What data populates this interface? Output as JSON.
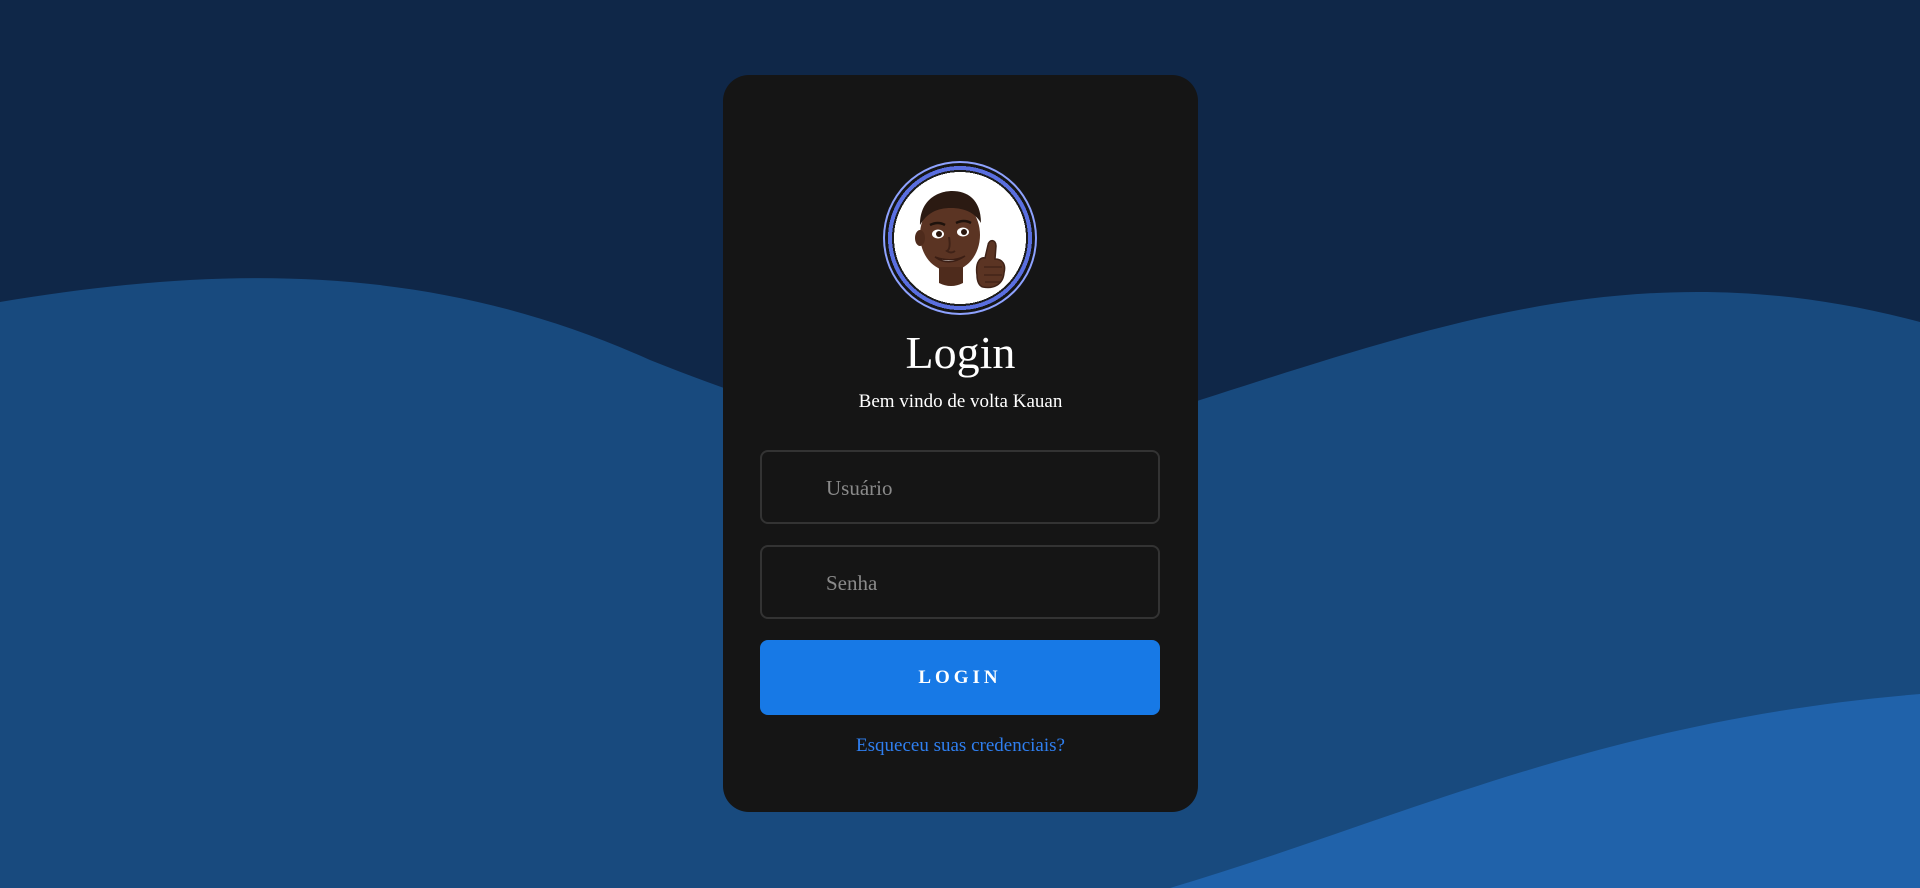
{
  "login": {
    "avatar_name": "memoji-avatar",
    "title": "Login",
    "subtitle": "Bem vindo de volta Kauan",
    "username_placeholder": "Usuário",
    "password_placeholder": "Senha",
    "button_label": "LOGIN",
    "forgot_link": "Esqueceu suas credenciais?"
  },
  "colors": {
    "background_top": "#0f2748",
    "wave_middle": "#184a7e",
    "wave_front": "#2062aa",
    "card": "#151515",
    "button": "#1779e6",
    "link": "#2f7ff0",
    "avatar_ring": "#5a6fe0"
  }
}
